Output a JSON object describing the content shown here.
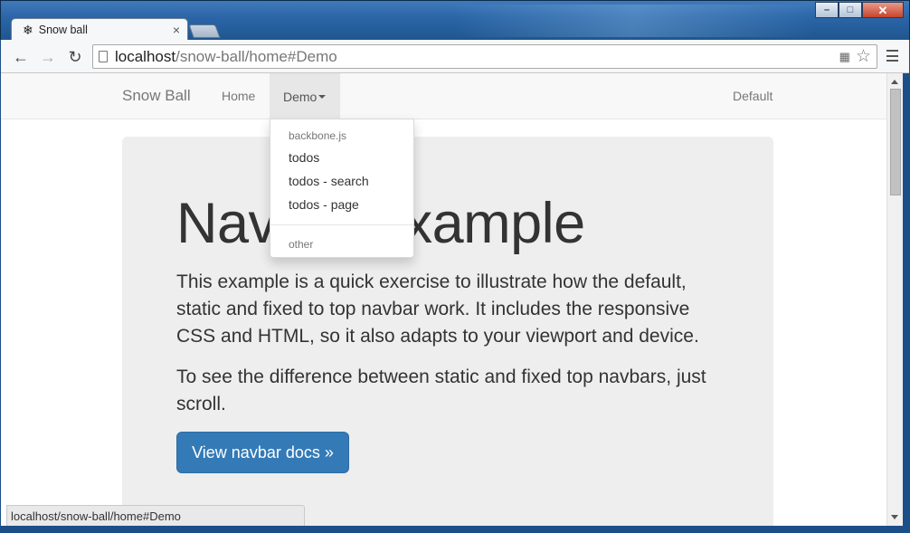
{
  "window": {
    "controls": {
      "minimize": "–",
      "maximize": "□",
      "close": "✕"
    }
  },
  "tab": {
    "title": "Snow ball",
    "favicon": "snowflake-icon",
    "close": "×"
  },
  "toolbar": {
    "url_host": "localhost",
    "url_path": "/snow-ball/home#Demo"
  },
  "navbar": {
    "brand": "Snow Ball",
    "home": "Home",
    "demo": "Demo",
    "default": "Default"
  },
  "dropdown": {
    "header1": "backbone.js",
    "items": [
      "todos",
      "todos - search",
      "todos - page"
    ],
    "header2": "other"
  },
  "jumbotron": {
    "heading": "Navbar example",
    "p1": "This example is a quick exercise to illustrate how the default, static and fixed to top navbar work. It includes the responsive CSS and HTML, so it also adapts to your viewport and device.",
    "p2": "To see the difference between static and fixed top navbars, just scroll.",
    "button": "View navbar docs »"
  },
  "status_bar": "localhost/snow-ball/home#Demo"
}
